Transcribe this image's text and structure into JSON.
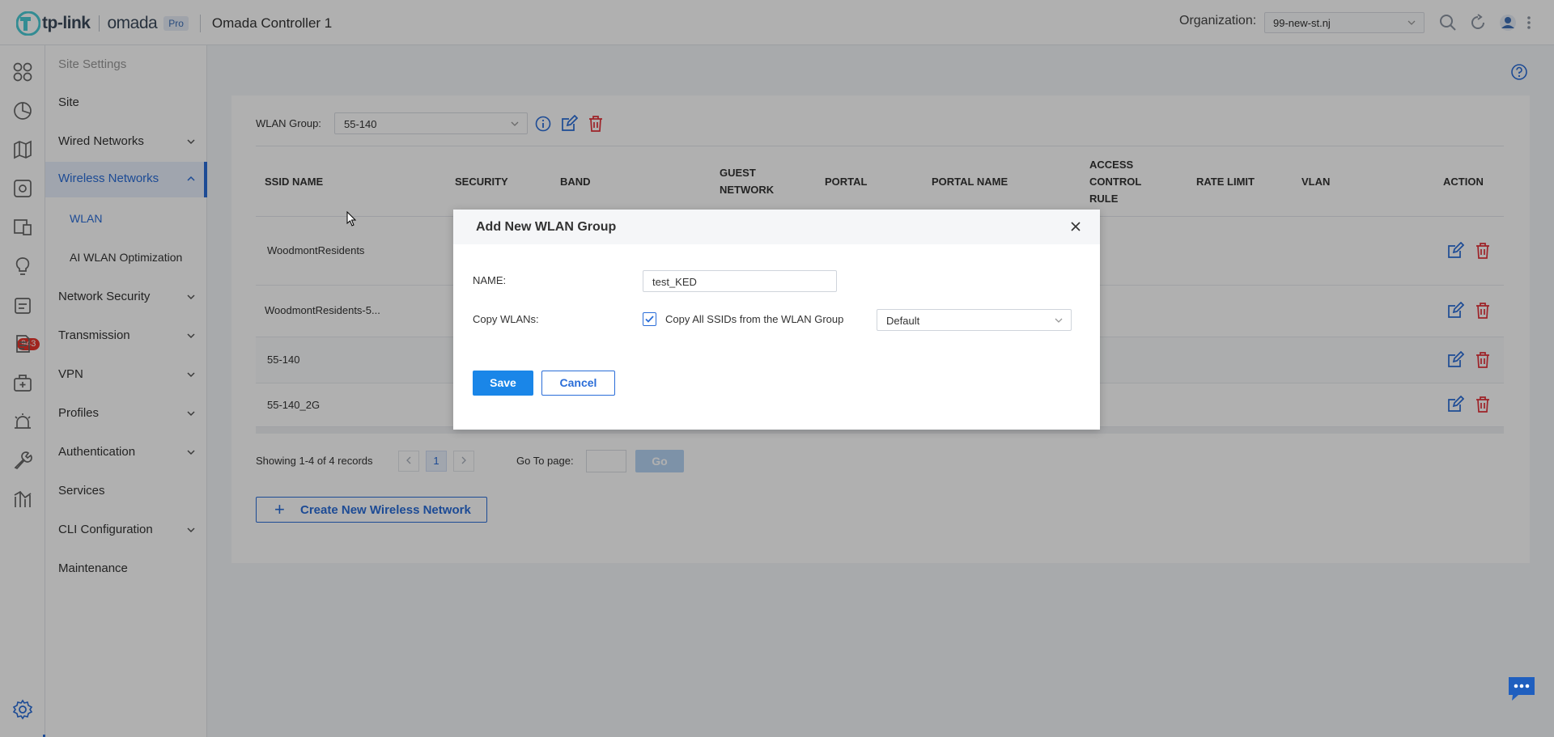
{
  "header": {
    "brand": "tp-link",
    "product": "omada",
    "badge": "Pro",
    "controller": "Omada Controller 1",
    "org_label": "Organization:",
    "org_value": "99-new-st.nj"
  },
  "rail": {
    "alerts_badge": "943",
    "icons": [
      "dashboard-icon",
      "statistics-icon",
      "map-icon",
      "devices-icon",
      "clients-icon",
      "insight-icon",
      "logs-icon",
      "reports-icon",
      "hotspot-icon",
      "alarm-icon",
      "tools-icon",
      "analytics-icon",
      "settings-icon"
    ]
  },
  "sitenav": {
    "title": "Site Settings",
    "items": [
      {
        "label": "Site"
      },
      {
        "label": "Wired Networks"
      },
      {
        "label": "Wireless Networks"
      },
      {
        "label": "WLAN"
      },
      {
        "label": "AI WLAN Optimization"
      },
      {
        "label": "Network Security"
      },
      {
        "label": "Transmission"
      },
      {
        "label": "VPN"
      },
      {
        "label": "Profiles"
      },
      {
        "label": "Authentication"
      },
      {
        "label": "Services"
      },
      {
        "label": "CLI Configuration"
      },
      {
        "label": "Maintenance"
      }
    ]
  },
  "wlan": {
    "group_label": "WLAN Group:",
    "group_value": "55-140",
    "columns": {
      "ssid": "SSID NAME",
      "security": "SECURITY",
      "band": "BAND",
      "guest_1": "GUEST",
      "guest_2": "NETWORK",
      "portal": "PORTAL",
      "portal_name": "PORTAL NAME",
      "acl_1": "ACCESS",
      "acl_2": "CONTROL",
      "acl_3": "RULE",
      "rate": "RATE LIMIT",
      "vlan": "VLAN",
      "action": "ACTION"
    },
    "rows": [
      {
        "ssid": "WoodmontResidents"
      },
      {
        "ssid": "WoodmontResidents-5..."
      },
      {
        "ssid": "55-140"
      },
      {
        "ssid": "55-140_2G"
      }
    ],
    "showing": "Showing 1-4 of 4 records",
    "current_page": "1",
    "goto_label": "Go To page:",
    "go_label": "Go",
    "create_label": "Create New Wireless Network"
  },
  "dialog": {
    "title": "Add New WLAN Group",
    "name_label": "NAME:",
    "name_value": "test_KED",
    "copy_label": "Copy WLANs:",
    "copy_checkbox_label": "Copy All SSIDs from the WLAN Group",
    "copy_checked": true,
    "copy_source": "Default",
    "save_label": "Save",
    "cancel_label": "Cancel"
  },
  "colors": {
    "accent": "#2a6dd8",
    "primary_button": "#1a86e8",
    "danger": "#e5323a",
    "badge": "#e8352c"
  }
}
